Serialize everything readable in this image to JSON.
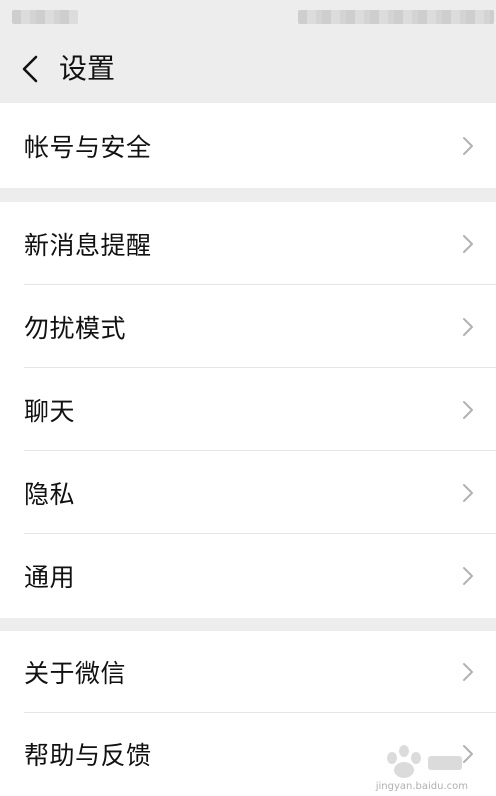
{
  "header": {
    "title": "设置",
    "back_icon": "chevron-left-icon"
  },
  "groups": [
    {
      "items": [
        {
          "label": "帐号与安全"
        }
      ]
    },
    {
      "items": [
        {
          "label": "新消息提醒"
        },
        {
          "label": "勿扰模式"
        },
        {
          "label": "聊天"
        },
        {
          "label": "隐私"
        },
        {
          "label": "通用"
        }
      ]
    },
    {
      "items": [
        {
          "label": "关于微信"
        },
        {
          "label": "帮助与反馈"
        }
      ]
    }
  ],
  "watermark": {
    "text": "jingyan.baidu.com"
  },
  "colors": {
    "background": "#ededed",
    "surface": "#ffffff",
    "text": "#111111",
    "chevron": "#b2b2b2",
    "divider": "#e6e6e6"
  }
}
